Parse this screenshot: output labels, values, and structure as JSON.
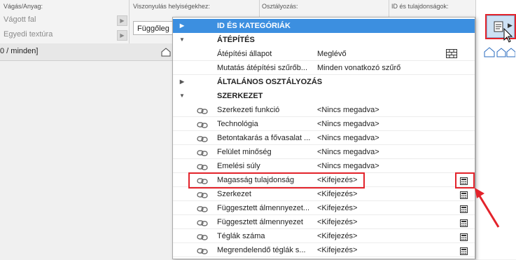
{
  "toolbar": {
    "label_vagas": "Vágás/Anyag:",
    "vagott_fal": "Vágott fal",
    "egyedi_textura": "Egyedi textúra",
    "label_viszony": "Viszonyulás helyiségekhez:",
    "combo_value": "Függőleg",
    "label_osztalyozas": "Osztályozás:",
    "label_id": "ID és tulajdonságok:"
  },
  "path_text": "0 / minden]",
  "popup": {
    "rows": [
      {
        "kind": "hdr",
        "name": "ID ÉS KATEGÓRIÁK",
        "expand": "right",
        "selected": true
      },
      {
        "kind": "hdr",
        "name": "ÁTÉPÍTÉS",
        "expand": "down"
      },
      {
        "kind": "prop",
        "name": "Átépítési állapot",
        "value": "Meglévő",
        "link": false,
        "icon": "brick"
      },
      {
        "kind": "prop",
        "name": "Mutatás átépítési szűrőb...",
        "value": "Minden vonatkozó szűrő",
        "link": false
      },
      {
        "kind": "hdr",
        "name": "ÁLTALÁNOS OSZTÁLYOZÁS",
        "expand": "right"
      },
      {
        "kind": "hdr",
        "name": "SZERKEZET",
        "expand": "down"
      },
      {
        "kind": "prop",
        "name": "Szerkezeti funkció",
        "value": "<Nincs megadva>",
        "link": true
      },
      {
        "kind": "prop",
        "name": "Technológia",
        "value": "<Nincs megadva>",
        "link": true
      },
      {
        "kind": "prop",
        "name": "Betontakarás a fővasalat ...",
        "value": "<Nincs megadva>",
        "link": true
      },
      {
        "kind": "prop",
        "name": "Felület minőség",
        "value": "<Nincs megadva>",
        "link": true
      },
      {
        "kind": "prop",
        "name": "Emelési súly",
        "value": "<Nincs megadva>",
        "link": true
      },
      {
        "kind": "prop",
        "name": "Magasság tulajdonság",
        "value": "<Kifejezés>",
        "link": true,
        "icon": "calc"
      },
      {
        "kind": "prop",
        "name": "Szerkezet",
        "value": "<Kifejezés>",
        "link": true,
        "icon": "calc"
      },
      {
        "kind": "prop",
        "name": "Függesztett álmennyezet...",
        "value": "<Kifejezés>",
        "link": true,
        "icon": "calc"
      },
      {
        "kind": "prop",
        "name": "Függesztett álmennyezet",
        "value": "<Kifejezés>",
        "link": true,
        "icon": "calc"
      },
      {
        "kind": "prop",
        "name": "Téglák száma",
        "value": "<Kifejezés>",
        "link": true,
        "icon": "calc"
      },
      {
        "kind": "prop",
        "name": "Megrendelendő téglák s...",
        "value": "<Kifejezés>",
        "link": true,
        "icon": "calc"
      }
    ]
  },
  "colors": {
    "selection": "#3c8fe0",
    "highlight": "#e3232b"
  },
  "icons": [
    "link-icon",
    "calculator-icon",
    "brick-wall-icon",
    "document-icon",
    "cursor-icon",
    "house-icon"
  ]
}
